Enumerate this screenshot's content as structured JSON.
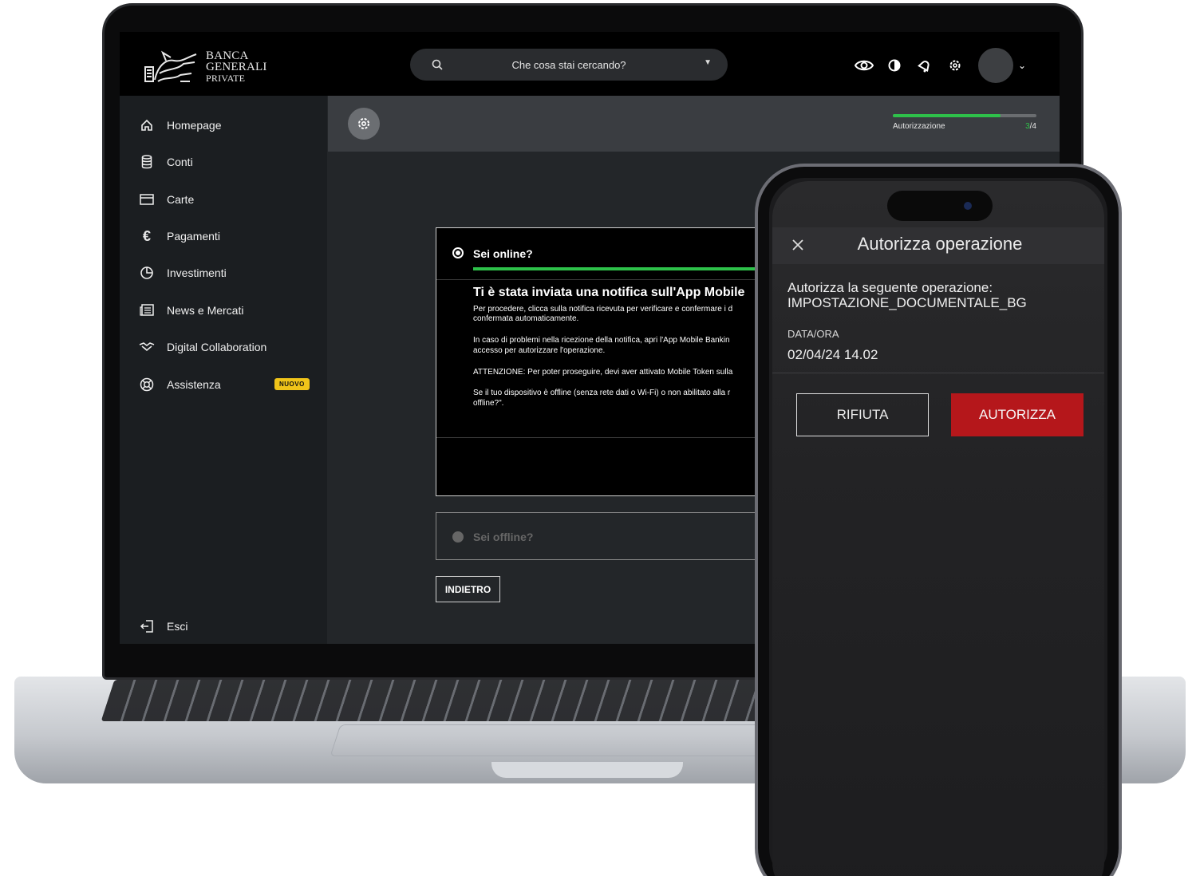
{
  "brand": {
    "line1": "BANCA",
    "line2": "GENERALI",
    "line3": "PRIVATE"
  },
  "search": {
    "placeholder": "Che cosa stai cercando?"
  },
  "sidebar": {
    "items": [
      {
        "label": "Homepage",
        "icon": "home-icon"
      },
      {
        "label": "Conti",
        "icon": "coins-icon"
      },
      {
        "label": "Carte",
        "icon": "card-icon"
      },
      {
        "label": "Pagamenti",
        "icon": "euro-icon"
      },
      {
        "label": "Investimenti",
        "icon": "pie-chart-icon"
      },
      {
        "label": "News e Mercati",
        "icon": "newspaper-icon"
      },
      {
        "label": "Digital Collaboration",
        "icon": "handshake-icon"
      },
      {
        "label": "Assistenza",
        "icon": "lifebuoy-icon",
        "badge": "NUOVO"
      }
    ],
    "logout": {
      "label": "Esci",
      "icon": "logout-icon"
    }
  },
  "progress": {
    "label": "Autorizzazione",
    "current": "3",
    "total": "/4",
    "fraction": 0.75
  },
  "online_card": {
    "title": "Sei online?",
    "heading": "Ti è stata inviata una notifica sull'App Mobile",
    "p1a": "Per procedere, clicca sulla notifica ricevuta per verificare e confermare i d",
    "p1b": "confermata automaticamente.",
    "p2a": "In caso di problemi nella ricezione della notifica, apri l'App Mobile Bankin",
    "p2b": "accesso per autorizzare l'operazione.",
    "p3": "ATTENZIONE: Per poter proseguire, devi aver attivato Mobile Token sulla",
    "p4a": "Se il tuo dispositivo è offline (senza rete dati o Wi-Fi) o non abilitato alla r",
    "p4b": "offline?\"."
  },
  "offline_card": {
    "title": "Sei offline?"
  },
  "back_button": "INDIETRO",
  "phone": {
    "title": "Autorizza operazione",
    "lead1": "Autorizza la seguente operazione:",
    "lead2": "IMPOSTAZIONE_DOCUMENTALE_BG",
    "datetime_label": "DATA/ORA",
    "datetime_value": "02/04/24 14.02",
    "reject": "RIFIUTA",
    "authorize": "AUTORIZZA"
  },
  "colors": {
    "accent_green": "#2ec14a",
    "badge_yellow": "#f0c419",
    "authorize_red": "#b5171b"
  }
}
